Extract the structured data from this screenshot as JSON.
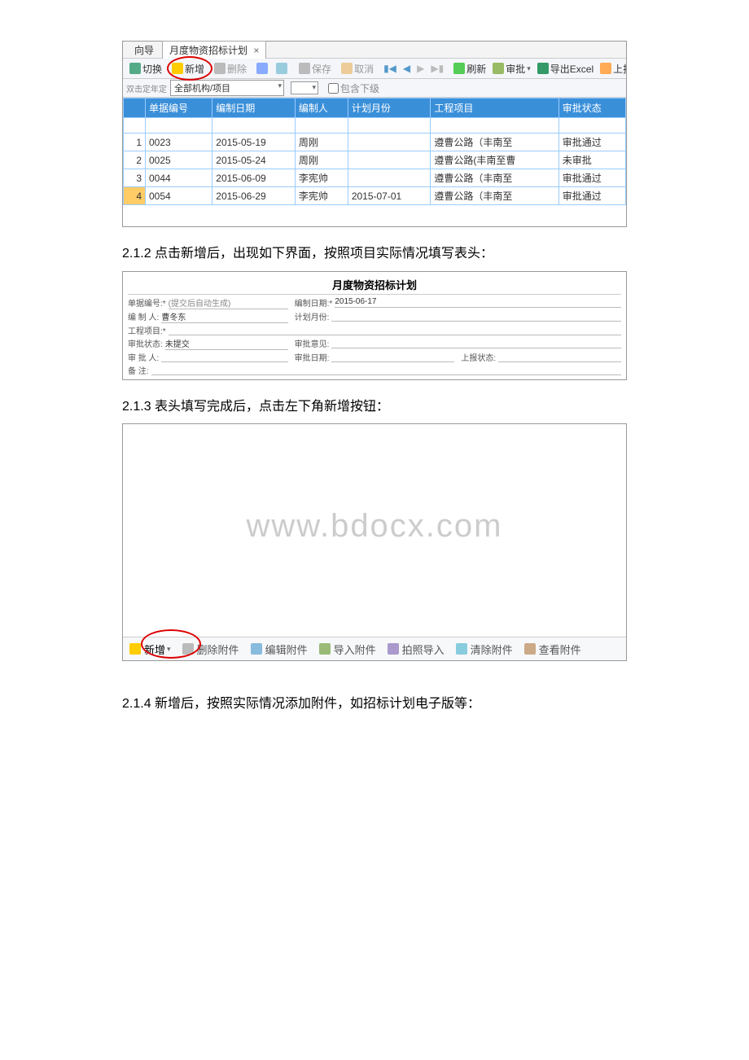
{
  "tabs": {
    "wizard": "向导",
    "active": "月度物资招标计划",
    "close": "×"
  },
  "toolbar": {
    "switch": "切换",
    "add": "新增",
    "delete": "删除",
    "save": "保存",
    "cancel": "取消",
    "refresh": "刷新",
    "approve": "审批",
    "export_excel": "导出Excel",
    "report": "上报"
  },
  "filter": {
    "prefix": "双击定年定",
    "org_label": "全部机构/项目",
    "include_sub": "包含下级"
  },
  "columns": {
    "doc_no": "单据编号",
    "compile_date": "编制日期",
    "compiler": "编制人",
    "plan_month": "计划月份",
    "project": "工程项目",
    "approval_status": "审批状态"
  },
  "rows": [
    {
      "n": "1",
      "doc_no": "0023",
      "compile_date": "2015-05-19",
      "compiler": "周刚",
      "plan_month": "",
      "project": "遵曹公路（丰南至",
      "status": "审批通过"
    },
    {
      "n": "2",
      "doc_no": "0025",
      "compile_date": "2015-05-24",
      "compiler": "周刚",
      "plan_month": "",
      "project": "遵曹公路(丰南至曹",
      "status": "未审批"
    },
    {
      "n": "3",
      "doc_no": "0044",
      "compile_date": "2015-06-09",
      "compiler": "李宪帅",
      "plan_month": "",
      "project": "遵曹公路（丰南至",
      "status": "审批通过"
    },
    {
      "n": "4",
      "doc_no": "0054",
      "compile_date": "2015-06-29",
      "compiler": "李宪帅",
      "plan_month": "2015-07-01",
      "project": "遵曹公路（丰南至",
      "status": "审批通过"
    }
  ],
  "text_212": "2.1.2 点击新增后，出现如下界面，按照项目实际情况填写表头：",
  "form": {
    "title": "月度物资招标计划",
    "doc_no_label": "单据编号:*",
    "doc_no_val": "(提交后自动生成)",
    "compile_date_label": "编制日期:*",
    "compile_date_val": "2015-06-17",
    "compiler_label": "编 制 人:",
    "compiler_val": "曹冬东",
    "plan_month_label": "计划月份:",
    "plan_month_val": "",
    "project_label": "工程项目:*",
    "project_val": "",
    "approve_status_label": "审批状态:",
    "approve_status_val": "未提交",
    "approve_opinion_label": "审批意见:",
    "approve_opinion_val": "",
    "approver_label": "审 批 人:",
    "approver_val": "",
    "approve_date_label": "审批日期:",
    "approve_date_val": "",
    "report_status_label": "上报状态:",
    "report_status_val": "",
    "remark_label": "备    注:",
    "remark_val": ""
  },
  "text_213": "2.1.3 表头填写完成后，点击左下角新增按钮：",
  "watermark": "www.bdocx.com",
  "toolbar2": {
    "add": "新增",
    "delete_attach": "删除附件",
    "edit_attach": "编辑附件",
    "import_attach": "导入附件",
    "photo_import": "拍照导入",
    "clear_attach": "清除附件",
    "view_attach": "查看附件"
  },
  "text_214": "2.1.4 新增后，按照实际情况添加附件，如招标计划电子版等："
}
